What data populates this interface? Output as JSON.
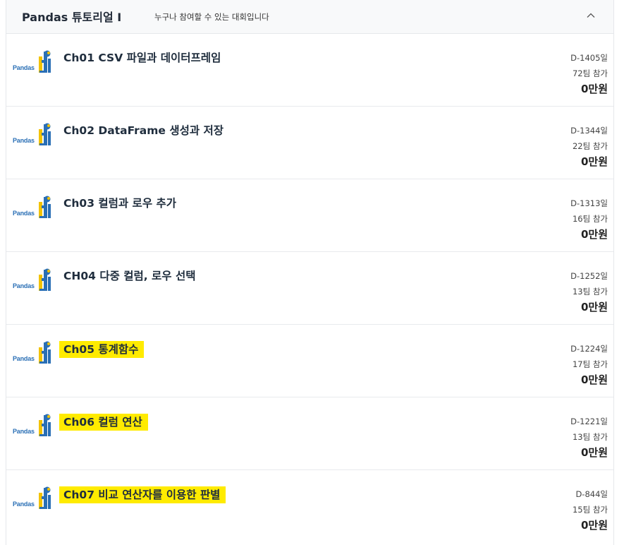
{
  "header": {
    "title": "Pandas 튜토리얼 I",
    "subtitle": "누구나 참여할 수 있는 대회입니다",
    "collapse_icon": "chevron-up-icon"
  },
  "logo_text": "Pandas",
  "competitions": [
    {
      "title": "Ch01 CSV 파일과 데이터프레임",
      "days": "D-1405일",
      "teams": "72팀 참가",
      "prize": "0만원",
      "highlighted": false
    },
    {
      "title": "Ch02 DataFrame 생성과 저장",
      "days": "D-1344일",
      "teams": "22팀 참가",
      "prize": "0만원",
      "highlighted": false
    },
    {
      "title": "Ch03 컬럼과 로우 추가",
      "days": "D-1313일",
      "teams": "16팀 참가",
      "prize": "0만원",
      "highlighted": false
    },
    {
      "title": "CH04 다중 컬럼, 로우 선택",
      "days": "D-1252일",
      "teams": "13팀 참가",
      "prize": "0만원",
      "highlighted": false
    },
    {
      "title": "Ch05 통계함수",
      "days": "D-1224일",
      "teams": "17팀 참가",
      "prize": "0만원",
      "highlighted": true
    },
    {
      "title": "Ch06 컬럼 연산",
      "days": "D-1221일",
      "teams": "13팀 참가",
      "prize": "0만원",
      "highlighted": true
    },
    {
      "title": "Ch07 비교 연산자를 이용한 판별",
      "days": "D-844일",
      "teams": "15팀 참가",
      "prize": "0만원",
      "highlighted": true
    }
  ],
  "colors": {
    "highlight": "#ffeb00",
    "logo_blue": "#2a6fb5",
    "logo_yellow": "#f2c200"
  }
}
